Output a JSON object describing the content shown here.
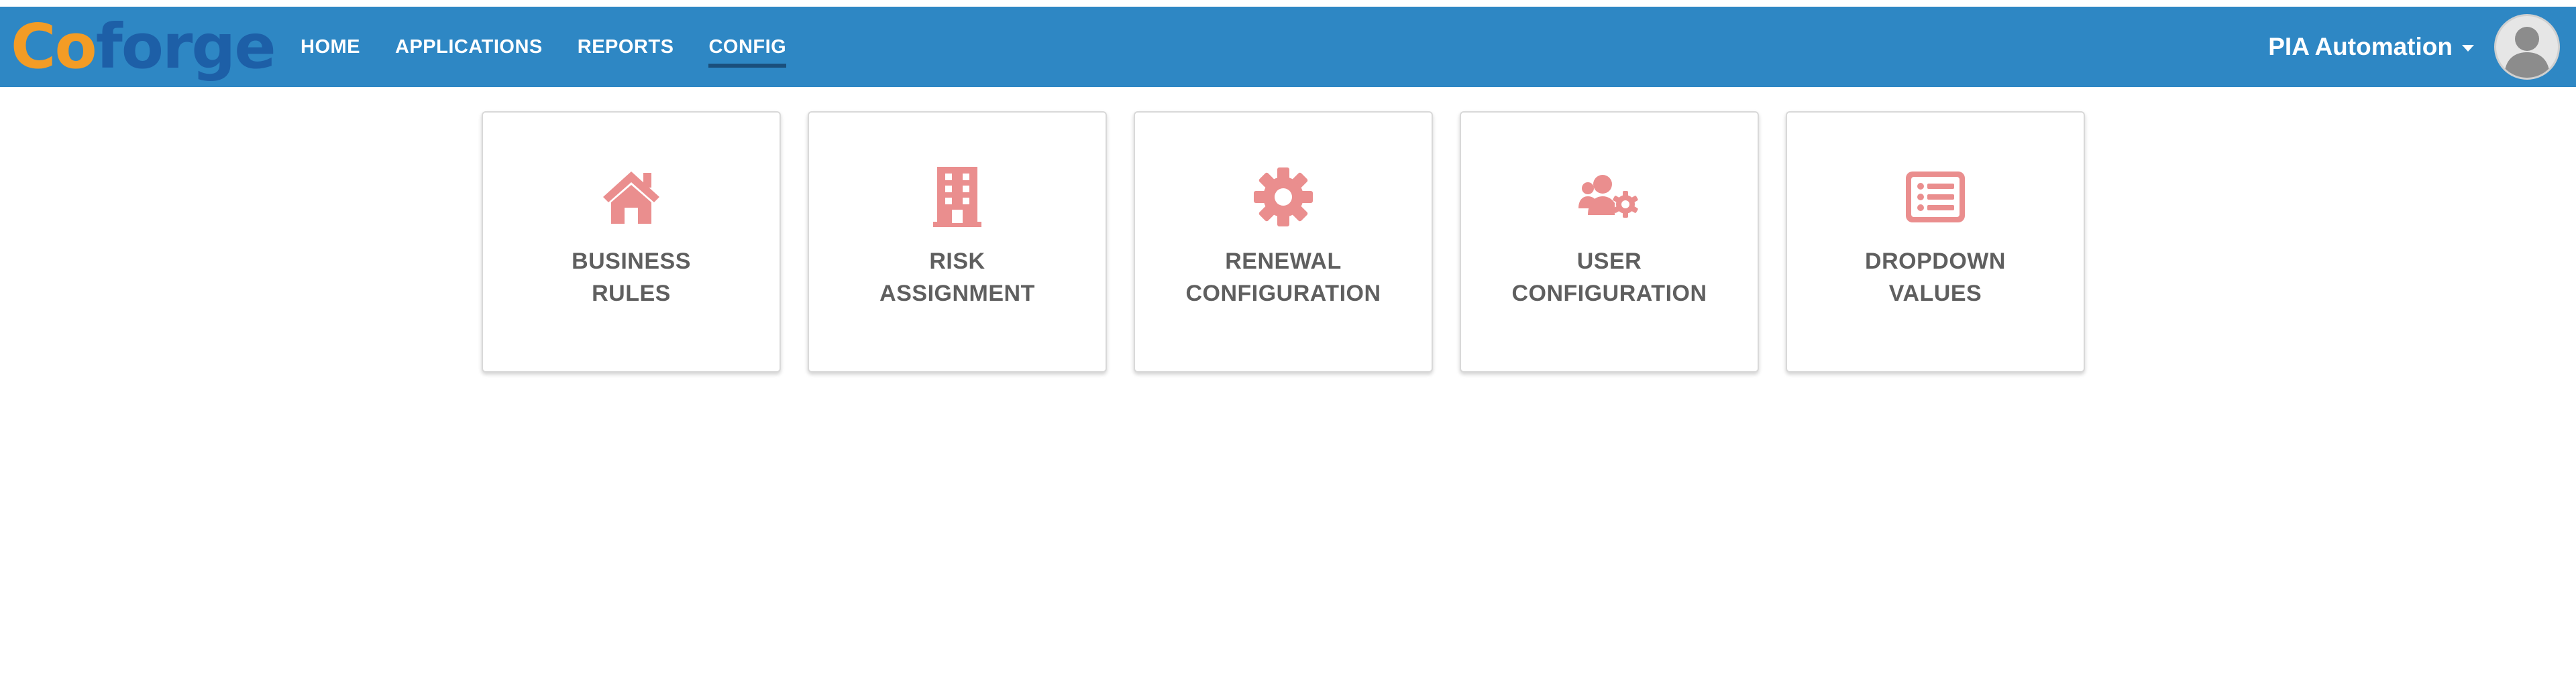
{
  "brand": {
    "logo_text_1": "C",
    "logo_text_2": "o",
    "logo_text_rest": "forge"
  },
  "nav": {
    "items": [
      {
        "label": "HOME"
      },
      {
        "label": "APPLICATIONS"
      },
      {
        "label": "REPORTS"
      },
      {
        "label": "CONFIG",
        "active": true
      }
    ]
  },
  "user": {
    "name": "PIA Automation",
    "menu_icon": "caret-down-icon",
    "avatar_icon": "user-avatar-icon"
  },
  "tiles": [
    {
      "line1": "BUSINESS",
      "line2": "RULES",
      "icon": "home-icon"
    },
    {
      "line1": "RISK",
      "line2": "ASSIGNMENT",
      "icon": "building-icon"
    },
    {
      "line1": "RENEWAL",
      "line2": "CONFIGURATION",
      "icon": "gear-icon"
    },
    {
      "line1": "USER",
      "line2": "CONFIGURATION",
      "icon": "users-cog-icon"
    },
    {
      "line1": "DROPDOWN",
      "line2": "VALUES",
      "icon": "list-icon"
    }
  ],
  "colors": {
    "navbar": "#2e87c4",
    "icon": "#ea8e8e",
    "tile_text": "#5f5f5f",
    "logo_orange": "#f39c25",
    "logo_blue": "#1d5fa7"
  }
}
